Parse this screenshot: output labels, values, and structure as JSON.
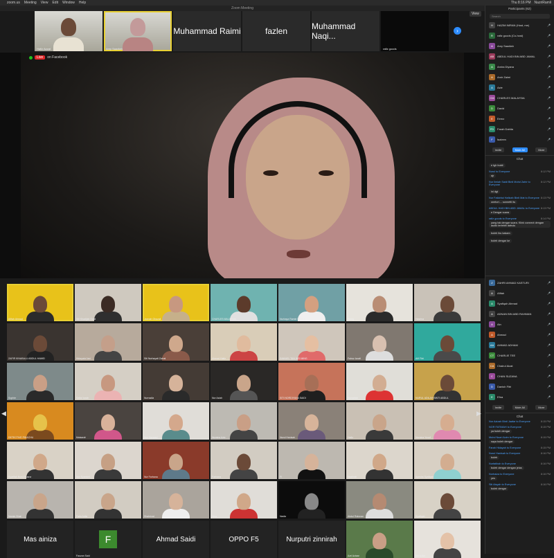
{
  "menubar": {
    "app": "zoom.us",
    "items": [
      "Meeting",
      "View",
      "Edit",
      "Window",
      "Help"
    ],
    "clock": "Thu 8:16 PM",
    "user": "NazriRamli"
  },
  "window_title": "Zoom Meeting",
  "view_button": "View",
  "top_strip": [
    {
      "label": "Hafiz Azzat",
      "type": "video"
    },
    {
      "label": "Amy Saadiah",
      "type": "video",
      "active": true
    },
    {
      "label": "Muhammad Raimi",
      "type": "name"
    },
    {
      "label": "fazlen",
      "type": "name"
    },
    {
      "label": "Muhammad Naqi...",
      "type": "name"
    },
    {
      "label": "rafiz goods",
      "type": "name"
    }
  ],
  "speaker": {
    "live_label": "Live",
    "live_on": "on Facebook"
  },
  "gallery": [
    {
      "cap": "Afifah Ahmad",
      "type": "video",
      "bg": "#e8c21a",
      "skin": "#6b4a38",
      "shirt": "#2b2b2b"
    },
    {
      "cap": "Siti Khadijah Sahil",
      "type": "video",
      "bg": "#cfc9bf",
      "skin": "#3b2b24",
      "shirt": "#2f2f2f"
    },
    {
      "cap": "Jannah Ghazali",
      "type": "video",
      "bg": "#e8c21a",
      "skin": "#c79880",
      "shirt": "#c6b08a"
    },
    {
      "cap": "CHARLES MALAYSIA",
      "type": "video",
      "bg": "#6fb3b0",
      "skin": "#5c3b2b",
      "shirt": "#e0e0e0"
    },
    {
      "cap": "Nurbaya Ramle Sabrina",
      "type": "video",
      "bg": "#70a0a5",
      "skin": "#d4a080",
      "shirt": "#efefef"
    },
    {
      "cap": "Wong",
      "type": "video",
      "bg": "#e6e3dc",
      "skin": "#b98d74",
      "shirt": "#2a2a2a"
    },
    {
      "cap": "Hasrina",
      "type": "video",
      "bg": "#c9c2b8",
      "skin": "#6b4a38",
      "shirt": "#3a3a3a"
    },
    {
      "cap": "ZAFIR KINABALU ABDUL HAMID",
      "type": "video",
      "bg": "#3a3430",
      "skin": "#6b4a38",
      "shirt": "#222"
    },
    {
      "cap": "Hidayatul Izni",
      "type": "video",
      "bg": "#b7aa9c",
      "skin": "#c49f8a",
      "shirt": "#444"
    },
    {
      "cap": "Siti Nurhayati Zainal",
      "type": "video",
      "bg": "#4a3f38",
      "skin": "#cfa88c",
      "shirt": "#8a5a4a"
    },
    {
      "cap": "Ahmad Hafiz",
      "type": "video",
      "bg": "#d9cdb8",
      "skin": "#e0bb9e",
      "shirt": "#c44"
    },
    {
      "cap": "SAMUEL TAN WEI MING",
      "type": "video",
      "bg": "#cfc6bb",
      "skin": "#e5bfa2",
      "shirt": "#e06a6a"
    },
    {
      "cap": "Fairuz Izzati",
      "type": "video",
      "bg": "#807870",
      "skin": "#d8c0b0",
      "shirt": "#ddd"
    },
    {
      "cap": "Alif Fitri",
      "type": "video",
      "bg": "#30a99d",
      "skin": "#6b4a38",
      "shirt": "#4a4a4a"
    },
    {
      "cap": "Sophie",
      "type": "video",
      "bg": "#7e8a8a",
      "skin": "#c99f86",
      "shirt": "#2a2a2a"
    },
    {
      "cap": "Saiful Izzah",
      "type": "video",
      "bg": "#d5cfc5",
      "skin": "#c79880",
      "shirt": "#ebb3b3"
    },
    {
      "cap": "Nurnadia",
      "type": "video",
      "bg": "#443b35",
      "skin": "#d6b39a",
      "shirt": "#2a2a2a"
    },
    {
      "cap": "Nor Aziah",
      "type": "video",
      "bg": "#2a2826",
      "skin": "#c9a58a",
      "shirt": "#555"
    },
    {
      "cap": "SITI NORDIYANA SAIDI",
      "type": "video",
      "bg": "#c6735a",
      "skin": "#a76f57",
      "shirt": "#1f1f1f"
    },
    {
      "cap": "Norazilah",
      "type": "video",
      "bg": "#e0ded8",
      "skin": "#d2ad92",
      "shirt": "#d33"
    },
    {
      "cap": "NURUL ADILAH BINTI ABDUL",
      "type": "video",
      "bg": "#c7a24b",
      "skin": "#6b4a38",
      "shirt": "#333"
    },
    {
      "cap": "DETECTIVE PIKACHU",
      "type": "video",
      "bg": "#d88a1f",
      "skin": "#e6c24a",
      "shirt": "#7b4a1e"
    },
    {
      "cap": "Maisarah",
      "type": "video",
      "bg": "#4a4440",
      "skin": "#d8b29a",
      "shirt": "#d1578a"
    },
    {
      "cap": "Nur Hazwani",
      "type": "video",
      "bg": "#e0ddd8",
      "skin": "#d4a88c",
      "shirt": "#5a8c8c"
    },
    {
      "cap": "Nuraina Aziz",
      "type": "video",
      "bg": "#bdbab3",
      "skin": "#c99f86",
      "shirt": "#444"
    },
    {
      "cap": "Nurul Hanisah",
      "type": "video",
      "bg": "#8a8178",
      "skin": "#d7b49a",
      "shirt": "#6a5a7a"
    },
    {
      "cap": "Hafiz",
      "type": "video",
      "bg": "#c9c0b4",
      "skin": "#c9a58a",
      "shirt": "#3a3a3a"
    },
    {
      "cap": "Nuraina Yusof",
      "type": "video",
      "bg": "#d0c6b8",
      "skin": "#d6ad90",
      "shirt": "#e089b0"
    },
    {
      "cap": "Syarifah Nurul Husna",
      "type": "video",
      "bg": "#d9d2c6",
      "skin": "#d0a889",
      "shirt": "#333"
    },
    {
      "cap": "Nor Syamimi",
      "type": "video",
      "bg": "#dcd6ce",
      "skin": "#c6a084",
      "shirt": "#3a3a3a"
    },
    {
      "cap": "Nur Farhana",
      "type": "video",
      "bg": "#8a3a2a",
      "skin": "#c9a58a",
      "shirt": "#5e7a8a"
    },
    {
      "cap": "Farhana",
      "type": "video",
      "bg": "#d2ccc2",
      "skin": "#6b4a38",
      "shirt": "#444"
    },
    {
      "cap": "FI",
      "type": "video",
      "bg": "#bdb8b0",
      "skin": "#d6b39a",
      "shirt": "#111"
    },
    {
      "cap": "Nazhrah",
      "type": "video",
      "bg": "#dcd6cc",
      "skin": "#d0a889",
      "shirt": "#333"
    },
    {
      "cap": "Ayesha Syafiqah",
      "type": "video",
      "bg": "#d8d0c4",
      "skin": "#d3ad90",
      "shirt": "#8fd0d0"
    },
    {
      "cap": "Norain Shah",
      "type": "video",
      "bg": "#b8b4ae",
      "skin": "#c9a58a",
      "shirt": "#333"
    },
    {
      "cap": "Fatin Adila",
      "type": "video",
      "bg": "#d2ccc2",
      "skin": "#c9a58a",
      "shirt": "#333"
    },
    {
      "cap": "Shahrizat",
      "type": "video",
      "bg": "#aaa49c",
      "skin": "#d6b39a",
      "shirt": "#eee"
    },
    {
      "cap": "Vera",
      "type": "video",
      "bg": "#e0ddd8",
      "skin": "#d0a889",
      "shirt": "#c33"
    },
    {
      "cap": "Nadia",
      "type": "video",
      "bg": "#0c0c0c",
      "skin": "#888",
      "shirt": "#222"
    },
    {
      "cap": "Abdul Rahman",
      "type": "video",
      "bg": "#8a8a80",
      "skin": "#b58a72",
      "shirt": "#ddd"
    },
    {
      "cap": "Syafiqah",
      "type": "video",
      "bg": "#d8d2c6",
      "skin": "#6b4a38",
      "shirt": "#444"
    },
    {
      "cap": "Mas ainiza",
      "type": "name"
    },
    {
      "cap": "F",
      "type": "avatar",
      "sub": "Fauzan Said"
    },
    {
      "cap": "Ahmad Saidi",
      "type": "name"
    },
    {
      "cap": "OPPO F5",
      "type": "name"
    },
    {
      "cap": "Nurputri zinnirah",
      "type": "name"
    },
    {
      "cap": "Azri Azizan",
      "type": "video",
      "bg": "#5a7a4a",
      "skin": "#c99f86",
      "shirt": "#2a4a2a"
    },
    {
      "cap": "Nurul Ain",
      "type": "video",
      "bg": "#e6e2dc",
      "skin": "#e4c2a8",
      "shirt": "#444"
    }
  ],
  "participants": {
    "title": "Participants (62)",
    "search_placeholder": "Search",
    "list": [
      {
        "name": "HAZIM IMRAN (Host, me)",
        "av": "H",
        "color": "#444"
      },
      {
        "name": "rafiz goods (Co-host)",
        "av": "R",
        "color": "#2a6a3a"
      },
      {
        "name": "Amy Saadiah",
        "av": "A",
        "color": "#8a4a9a"
      },
      {
        "name": "ABDUL HADI BIN ABD JAMAL",
        "av": "AB",
        "color": "#9a3a5a"
      },
      {
        "name": "Amira Diyana",
        "av": "A",
        "color": "#3a8a4a"
      },
      {
        "name": "Amir Zaimi",
        "av": "A",
        "color": "#aa6a2a"
      },
      {
        "name": "Azie",
        "av": "A",
        "color": "#2a7a9a"
      },
      {
        "name": "CHARLES MALAYSIA",
        "av": "CM",
        "color": "#9a4a9a"
      },
      {
        "name": "David",
        "av": "D",
        "color": "#3a8a3a"
      },
      {
        "name": "Eemz",
        "av": "E",
        "color": "#c05a2a"
      },
      {
        "name": "Farah Dahlia",
        "av": "FD",
        "color": "#2a8a6a"
      },
      {
        "name": "fazleen",
        "av": "F",
        "color": "#3a5aaa"
      }
    ],
    "buttons": [
      "Invite",
      "Mute All",
      "More"
    ]
  },
  "chat_top": {
    "title": "Chat",
    "messages": [
      {
        "from": "",
        "text": "e tgh bukti",
        "time": ""
      },
      {
        "from": "Nurul to Everyone",
        "text": "ajr",
        "time": "8:12 PM"
      },
      {
        "from": "Nur Ilmiah Saidi Binti Mohd Zahir to Everyone",
        "text": "",
        "time": "8:12 PM"
      },
      {
        "from": "",
        "text": "ini dgt",
        "time": ""
      },
      {
        "from": "Nur Fatiahtul Hafizah Binti Mat to Everyone",
        "text": "onetori.... sonnetti itu",
        "time": "8:13 PM"
      },
      {
        "from": "ABDUL HADI BIN ABD JAMAL to Everyone",
        "text": "e Dengar suara",
        "time": "8:13 PM"
      },
      {
        "from": "rafiz goods to Everyone",
        "text": "yang tak dengar suara. Klink connect dengan audio terlebih dahulu",
        "time": "8:14 PM"
      },
      {
        "from": "",
        "text": "boleh ibu kakam",
        "time": ""
      },
      {
        "from": "",
        "text": "boleh dengar ke",
        "time": ""
      }
    ]
  },
  "participants_bottom": {
    "list": [
      {
        "name": "ZAHRI AHMAD KASTURI",
        "av": "Z",
        "color": "#3a6a9a"
      },
      {
        "name": "Afifah",
        "av": "A",
        "color": "#444"
      },
      {
        "name": "Syafiqah Ahmad",
        "av": "A",
        "color": "#2a8a6a"
      },
      {
        "name": "ADNAN BIN ABD RAHMAN",
        "av": "A",
        "color": "#444"
      },
      {
        "name": "Ain",
        "av": "A",
        "color": "#8a4a9a"
      },
      {
        "name": "Ahmad",
        "av": "A",
        "color": "#c05a2a"
      },
      {
        "name": "AHMAD ADHAM",
        "av": "AA",
        "color": "#2a7a9a"
      },
      {
        "name": "CHARLIE TEE",
        "av": "CT",
        "color": "#3a8a3a"
      },
      {
        "name": "Chairul Aizat",
        "av": "CA",
        "color": "#aa6a2a"
      },
      {
        "name": "CHAN SUZANA",
        "av": "C",
        "color": "#9a4a9a"
      },
      {
        "name": "Danish Fitri",
        "av": "D",
        "color": "#3a5aaa"
      },
      {
        "name": "Efna",
        "av": "E",
        "color": "#2a8a6a"
      }
    ],
    "buttons": [
      "Invite",
      "Mute All",
      "More"
    ]
  },
  "chat_bottom": {
    "title": "Chat",
    "messages": [
      {
        "from": "Nor Azizah Binti Jaafar to Everyone",
        "text": "",
        "time": "8:15 PM"
      },
      {
        "from": "NOR FATIMAH to Everyone",
        "text": "ya boleh dengar",
        "time": "8:15 PM"
      },
      {
        "from": "Muhd Nazri Azim to Everyone",
        "text": "saya boleh dengar",
        "time": "8:15 PM"
      },
      {
        "from": "Farah Hidayah to Everyone",
        "text": "",
        "time": "8:15 PM"
      },
      {
        "from": "Nurul Hanisah to Everyone",
        "text": "boleh",
        "time": "8:16 PM"
      },
      {
        "from": "Nurfatihah to Everyone",
        "text": "boleh dengar dengan jelas",
        "time": "8:16 PM"
      },
      {
        "from": "Norhaiza to Everyone",
        "text": "yes",
        "time": "8:16 PM"
      },
      {
        "from": "Siti Aisyah to Everyone",
        "text": "boleh dengar",
        "time": "8:16 PM"
      }
    ]
  }
}
